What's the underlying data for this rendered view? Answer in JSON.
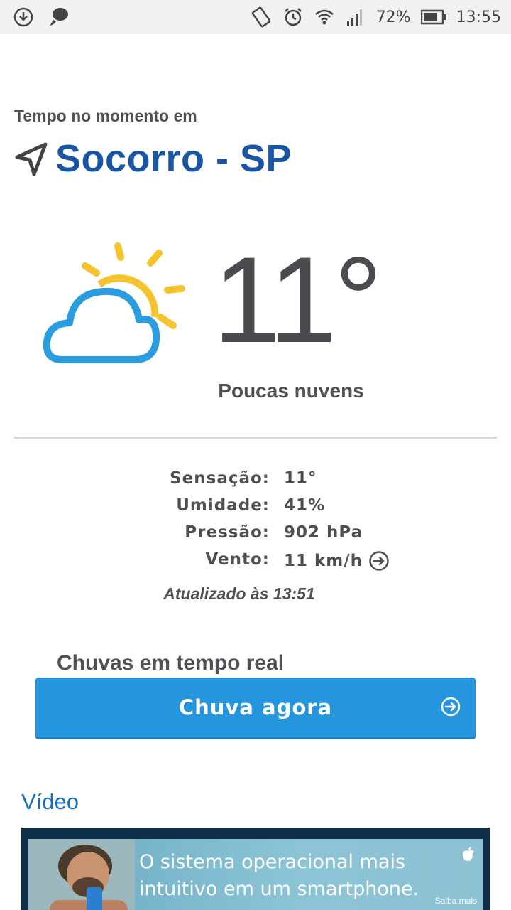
{
  "status_bar": {
    "battery": "72%",
    "time": "13:55"
  },
  "header": {
    "subtitle": "Tempo no momento em",
    "city": "Socorro - SP"
  },
  "current": {
    "temperature": "11°",
    "condition": "Poucas nuvens",
    "icon": "partly-cloudy-icon"
  },
  "details": [
    {
      "label": "Sensação:",
      "value": "11°"
    },
    {
      "label": "Umidade:",
      "value": "41%"
    },
    {
      "label": "Pressão:",
      "value": "902 hPa"
    },
    {
      "label": "Vento:",
      "value": "11 km/h"
    }
  ],
  "updated": "Atualizado às 13:51",
  "rain": {
    "title": "Chuvas em tempo real",
    "button_label": "Chuva agora"
  },
  "video": {
    "title": "Vídeo",
    "ad_text": "O sistema operacional mais intuitivo em um smartphone.",
    "ad_more": "Saiba mais"
  },
  "colors": {
    "accent_blue": "#1a55a3",
    "button_blue": "#2596dd",
    "sun_yellow": "#f5c42c",
    "cloud_blue": "#2a9de0"
  }
}
